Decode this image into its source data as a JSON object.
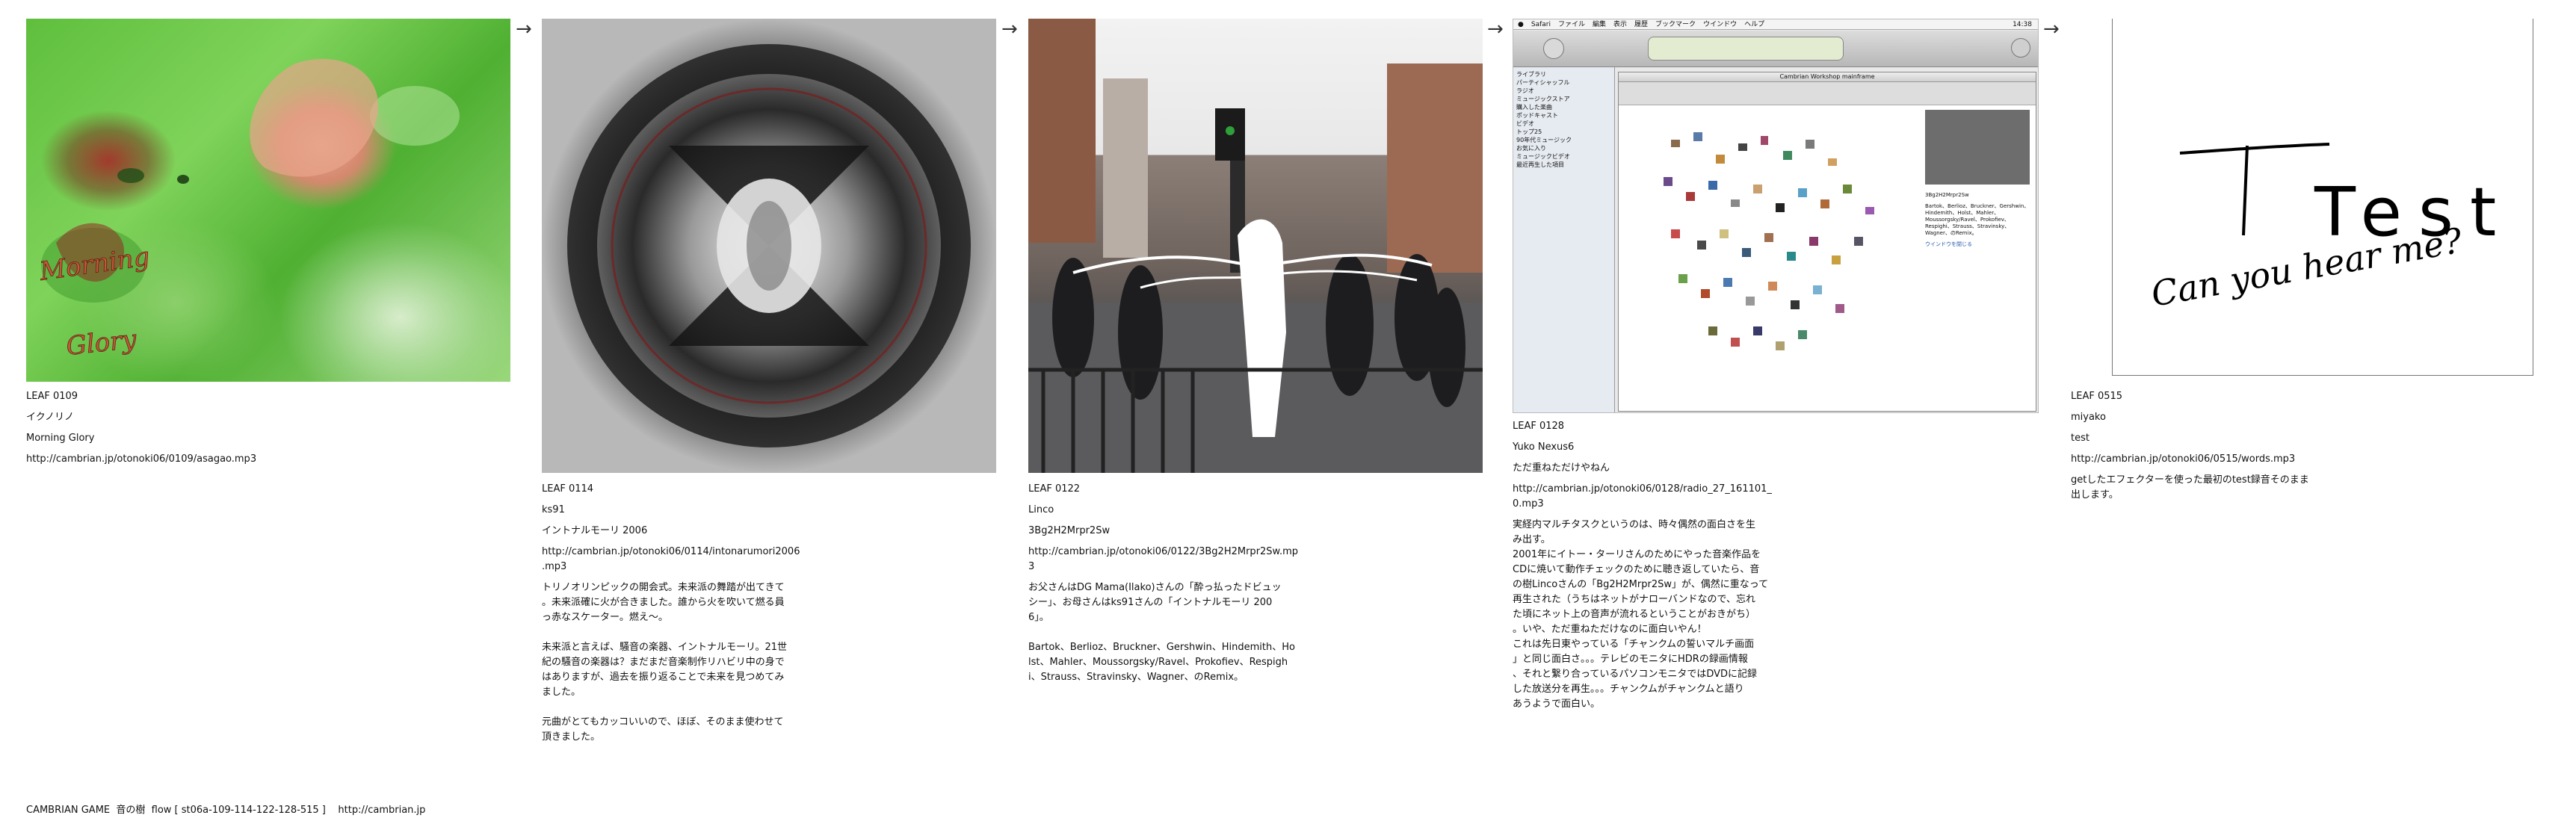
{
  "leaves": [
    {
      "id": "LEAF 0109",
      "author": "イクノリノ",
      "title": "Morning Glory",
      "url": "http://cambrian.jp/otonoki06/0109/asagao.mp3",
      "image_text": [
        "Morning",
        "Glory"
      ],
      "description": ""
    },
    {
      "id": "LEAF 0114",
      "author": "ks91",
      "title": "イントナルモーリ 2006",
      "url": "http://cambrian.jp/otonoki06/0114/intonarumori2006\n.mp3",
      "description": "トリノオリンピックの開会式。未来派の舞踏が出てきて\n。未来派確に火が合きました。誰から火を吹いて燃る員\nっ赤なスケーター。燃え〜。\n\n未来派と言えば、騒音の楽器、イントナルモーリ。21世\n紀の騒音の楽器は？まだまだ音楽制作リハビリ中の身で\nはありますが、過去を振り返ることで未来を見つめてみ\nました。\n\n元曲がとてもカッコいいので、ほぼ、そのまま使わせて\n頂きました。"
    },
    {
      "id": "LEAF 0122",
      "author": "Linco",
      "title": "3Bg2H2Mrpr2Sw",
      "url": "http://cambrian.jp/otonoki06/0122/3Bg2H2Mrpr2Sw.mp\n3",
      "description": "お父さんはDG Mama(Ilako)さんの「酔っ払ったドビュッ\nシー」、お母さんはks91さんの「イントナルモーリ 200\n6」。\n\nBartok、Berlioz、Bruckner、Gershwin、Hindemith、Ho\nlst、Mahler、Moussorgsky/Ravel、Prokofiev、Respigh\ni、Strauss、Stravinsky、Wagner、のRemix。"
    },
    {
      "id": "LEAF 0128",
      "author": "Yuko Nexus6",
      "title": "ただ重ねただけやねん",
      "url": "http://cambrian.jp/otonoki06/0128/radio_27_161101_\n0.mp3",
      "description": "実経内マルチタスクというのは、時々偶然の面白さを生\nみ出す。\n2001年にイトー・ターリさんのためにやった音楽作品を\nCDに焼いて動作チェックのために聴き返していたら、音\nの樹Lincoさんの「Bg2H2Mrpr2Sw」が、偶然に重なって\n再生された（うちはネットがナローバンドなので、忘れ\nた頃にネット上の音声が流れるということがおきがち）\n。いや、ただ重ねただけなのに面白いやん！\nこれは先日東やっている「チャンクムの誓いマルチ画面\n」と同じ面白さ。。。テレビのモニタにHDRの録画情報\n、それと繋り合っているパソコンモニタではDVDに記録\nした放送分を再生。。。チャンクムがチャンクムと語り\nあうようで面白い。"
    },
    {
      "id": "LEAF 0515",
      "author": "miyako",
      "title": "test",
      "url": "http://cambrian.jp/otonoki06/0515/words.mp3",
      "image_text": [
        "Test",
        "Can you hear me?"
      ],
      "description": "getしたエフェクターを使った最初のtest録音そのまま\n出します。"
    }
  ],
  "screenshot_0128": {
    "menubar": [
      "Safari",
      "ファイル",
      "編集",
      "表示",
      "履歴",
      "ブックマーク",
      "ウインドウ",
      "ヘルプ"
    ],
    "page_title": "Cambrian Workshop mainframe",
    "sidebar_items": [
      "ライブラリ",
      "パーティシャッフル",
      "ラジオ",
      "ミュージックストア",
      "購入した楽曲",
      "ポッドキャスト",
      "ビデオ",
      "トップ25",
      "90年代ミュージック",
      "お気に入り",
      "ミュージックビデオ",
      "最近再生した項目"
    ],
    "side_text": "3Bg2H2Mrpr2Sw",
    "side_link": "ウインドウを閉じる",
    "side_caption": "Bartok、Berlioz、Bruckner、Gershwin、Hindemith、Holst、Mahler、Moussorgsky/Ravel、Prokofiev、Respighi、Strauss、Stravinsky、Wagner、のRemix。",
    "clock": "14:38"
  },
  "arrow_glyph": "→",
  "footer": "CAMBRIAN GAME  音の樹  flow [ st06a-109-114-122-128-515 ]    http://cambrian.jp"
}
